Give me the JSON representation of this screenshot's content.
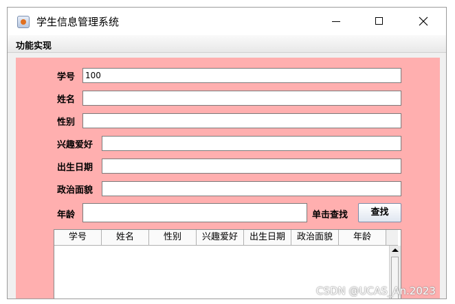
{
  "window": {
    "title": "学生信息管理系统"
  },
  "menubar": {
    "item": "功能实现"
  },
  "form": {
    "xuehao_label": "学号",
    "xuehao_value": "100",
    "xingming_label": "姓名",
    "xingming_value": "",
    "xingbie_label": "性别",
    "xingbie_value": "",
    "xingqu_label": "兴趣爱好",
    "xingqu_value": "",
    "chusheng_label": "出生日期",
    "chusheng_value": "",
    "zhengzhi_label": "政治面貌",
    "zhengzhi_value": "",
    "nianling_label": "年龄",
    "nianling_value": "",
    "search_label": "单击查找",
    "search_button": "查找"
  },
  "table": {
    "columns": [
      "学号",
      "姓名",
      "性别",
      "兴趣爱好",
      "出生日期",
      "政治面貌",
      "年龄"
    ]
  },
  "watermark": "CSDN @UCAS_An.2023",
  "colors": {
    "content_bg": "#ffafaf"
  }
}
